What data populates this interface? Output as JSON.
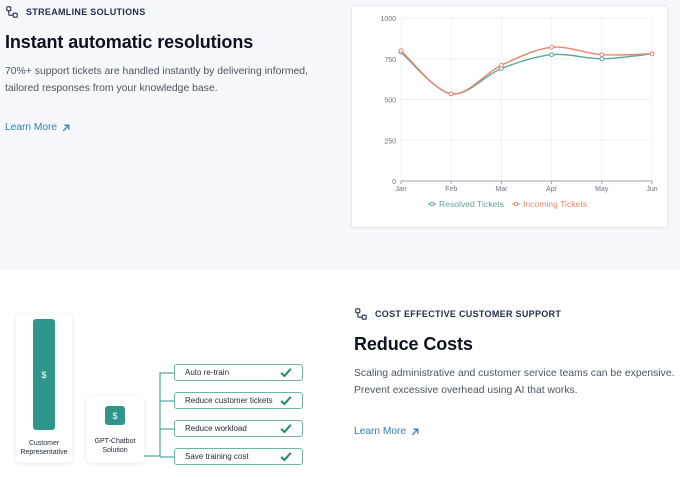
{
  "section1": {
    "eyebrow": "STREAMLINE SOLUTIONS",
    "title": "Instant automatic resolutions",
    "description_line1": "70%+ support tickets are handled instantly by delivering informed,",
    "description_line2": "tailored responses from your knowledge base.",
    "learn_more": "Learn More",
    "learn_more_icon": "arrow-up-right-icon"
  },
  "section2": {
    "eyebrow": "COST EFFECTIVE CUSTOMER SUPPORT",
    "title": "Reduce Costs",
    "description_line1": "Scaling administrative and customer service teams can be expensive.",
    "description_line2": "Prevent excessive overhead using AI that works.",
    "learn_more": "Learn More",
    "learn_more_icon": "arrow-up-right-icon"
  },
  "illustration": {
    "card1_line1": "Customer",
    "card1_line2": "Representative",
    "card2_line1": "GPT-Chatbot",
    "card2_line2": "Solution",
    "dollar_symbol": "$",
    "benefits": [
      "Auto re-train",
      "Reduce customer tickets",
      "Reduce workload",
      "Save training cost"
    ],
    "accent_color": "#2e968b",
    "check_color": "#1f8a6c"
  },
  "chart_data": {
    "type": "line",
    "categories": [
      "Jan",
      "Feb",
      "Mar",
      "Apr",
      "May",
      "Jun"
    ],
    "series": [
      {
        "name": "Resolved Tickets",
        "color": "#5aa89a",
        "values": [
          790,
          535,
          690,
          775,
          750,
          780
        ]
      },
      {
        "name": "Incoming Tickets",
        "color": "#e8866c",
        "values": [
          800,
          535,
          710,
          820,
          775,
          780
        ]
      }
    ],
    "yticks": [
      0,
      250,
      500,
      750,
      1000
    ],
    "ylim": [
      0,
      1000
    ],
    "legend_position": "bottom",
    "grid": true
  }
}
